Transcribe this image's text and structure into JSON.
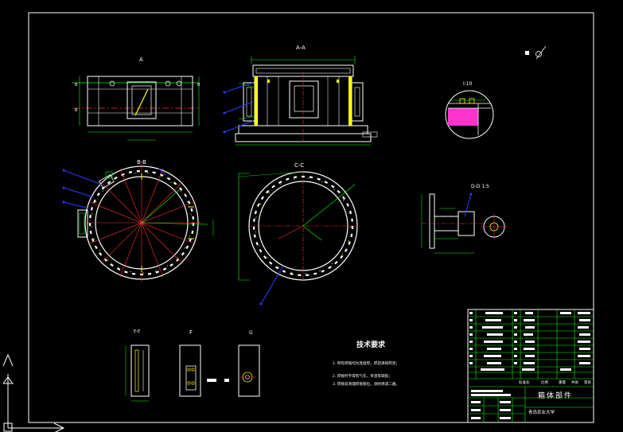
{
  "drawing": {
    "colors": {
      "background": "#000000",
      "frame": "#ffffff",
      "outline": "#ffffff",
      "dimension": "#00ff00",
      "center": "#ff3030",
      "leader": "#2a3cff",
      "highlight": "#ffff00",
      "hatch": "#ff33cc"
    },
    "views": {
      "front_label": "A",
      "aa_label": "A-A",
      "detail_label": "I:10",
      "bb_label": "B-B",
      "cc_label": "C-C",
      "dd_label": "D-D 1:5",
      "ee_label": "E-E",
      "f_label": "F",
      "g_label": "G"
    },
    "notes": {
      "title": "技术要求",
      "items": [
        "1. 所有焊缝均为连续焊，焊后清除焊渣；",
        "2. 焊接时不得有气孔、夹渣等缺陷；",
        "3. 焊接前清理焊接部位，涂防锈漆二遍。"
      ]
    },
    "title_block": {
      "part_name": "箱体部件",
      "school": "青岛农业大学",
      "mid_labels": [
        "标准化",
        "比例",
        "重量",
        "共张",
        "第张"
      ]
    }
  }
}
